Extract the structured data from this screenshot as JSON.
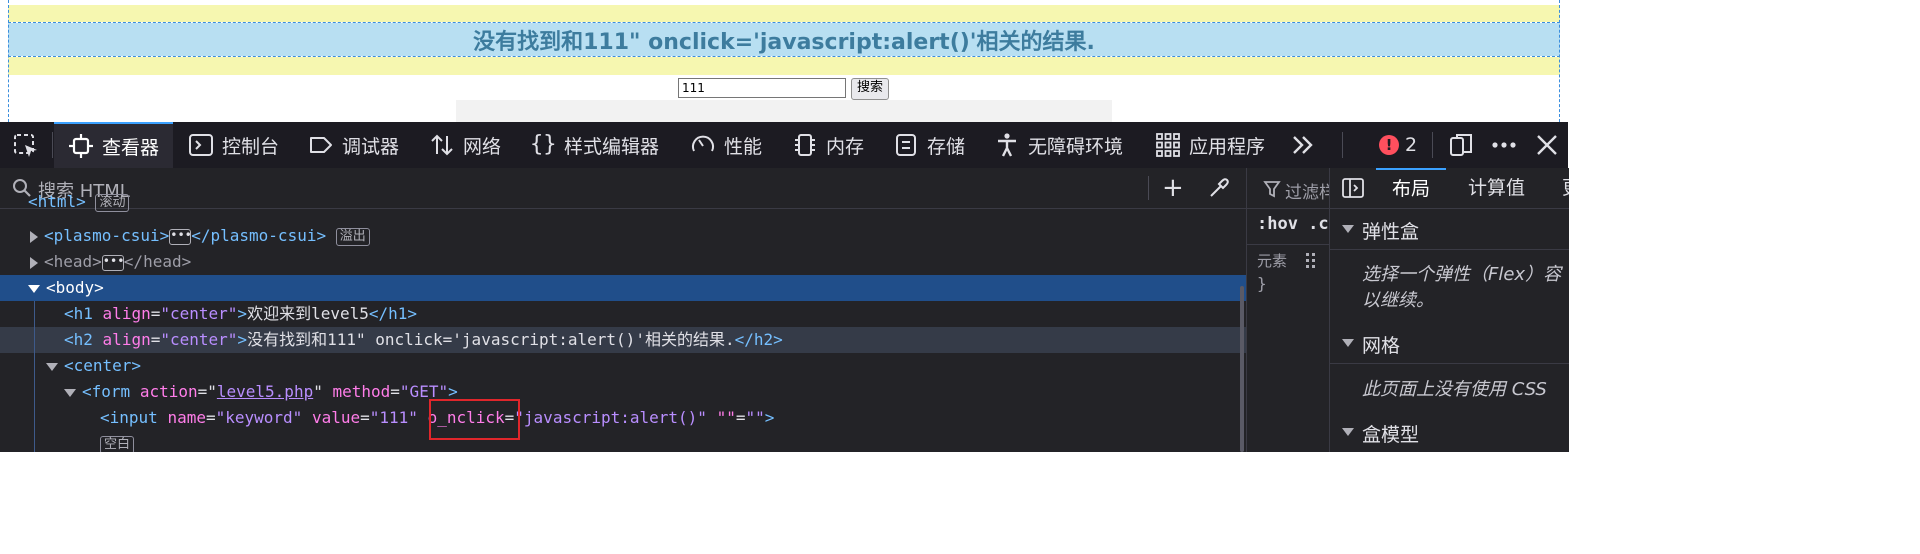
{
  "page": {
    "h2_text": "没有找到和111\" onclick='javascript:alert()'相关的结果.",
    "keyword_value": "111",
    "search_button": "搜索"
  },
  "toolbar": {
    "tabs": [
      "查看器",
      "控制台",
      "调试器",
      "网络",
      "样式编辑器",
      "性能",
      "内存",
      "存储",
      "无障碍环境",
      "应用程序"
    ],
    "error_count": "2",
    "icons": [
      "picker-icon",
      "inspector-icon",
      "console-icon",
      "debugger-icon",
      "network-icon",
      "style-editor-icon",
      "performance-icon",
      "memory-icon",
      "storage-icon",
      "accessibility-icon",
      "application-icon",
      "overflow-chevrons-icon",
      "error-icon",
      "responsive-icon",
      "more-icon",
      "close-icon"
    ]
  },
  "markup": {
    "search_placeholder": "搜索 HTML",
    "line0_tag": "<html>",
    "line0_badge": "滚动",
    "line1_open": "<plasmo-csui>",
    "line1_close": "</plasmo-csui>",
    "line1_badge": "溢出",
    "line2_open": "<head>",
    "line2_close": "</head>",
    "line3_tag": "<body>",
    "line4": {
      "open": "<h1",
      "attr": "align",
      "val": "\"center\"",
      "text": "欢迎来到level5",
      "close": "</h1>"
    },
    "line5": {
      "open": "<h2",
      "attr": "align",
      "val": "\"center\"",
      "text": "没有找到和111\" onclick='javascript:alert()'相关的结果.",
      "close": "</h2>"
    },
    "line6_tag": "<center>",
    "line7": {
      "open": "<form",
      "attr1": "action",
      "val1": "level5.php",
      "attr2": "method",
      "val2": "\"GET\""
    },
    "line8": {
      "open": "<input",
      "attr1": "name",
      "val1": "\"keyword\"",
      "attr2": "value",
      "val2": "\"111\"",
      "attr3": "o_nclick",
      "val3": "\"javascript:alert()\"",
      "attr4": "\"\"",
      "val4": "\"\""
    },
    "line9_badge": "空白"
  },
  "rules": {
    "filter_placeholder": "过滤样",
    "hov": ":hov .cl",
    "element_label": "元素",
    "brace": "}"
  },
  "layout_panel": {
    "tabs": [
      "布局",
      "计算值",
      "更"
    ],
    "flexbox_title": "弹性盒",
    "flexbox_hint_1": "选择一个弹性（Flex）容",
    "flexbox_hint_2": "以继续。",
    "grid_title": "网格",
    "grid_hint": "此页面上没有使用 CSS",
    "boxmodel_title": "盒模型"
  },
  "colors": {
    "highlight_margin": "#f6f7b0",
    "highlight_content": "#b8dff2",
    "devtools_bg": "#232327",
    "selected_row": "#204e8a",
    "red_box": "#e0262b"
  }
}
